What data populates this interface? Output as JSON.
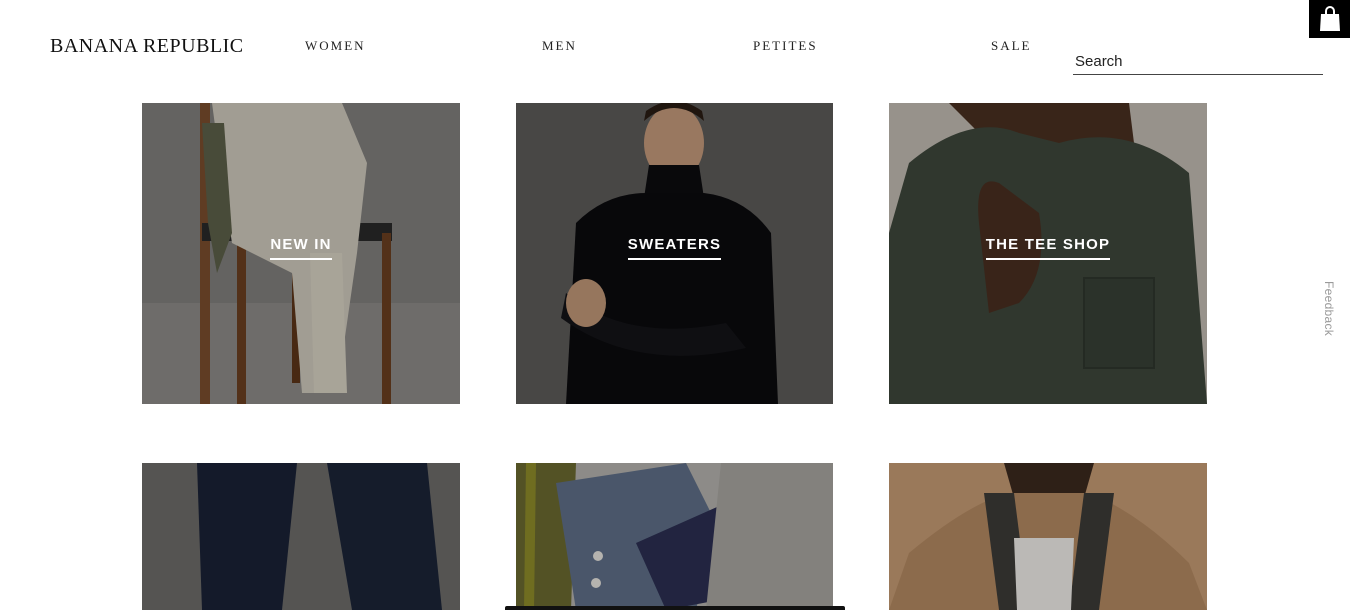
{
  "header": {
    "logo": "BANANA REPUBLIC",
    "nav": [
      "WOMEN",
      "MEN",
      "PETITES",
      "SALE"
    ],
    "search_placeholder": "Search"
  },
  "icons": {
    "bag": "shopping-bag-icon"
  },
  "feedback_label": "Feedback",
  "tiles": [
    {
      "label": "NEW IN",
      "image": "sweater-on-chair"
    },
    {
      "label": "SWEATERS",
      "image": "man-black-turtleneck"
    },
    {
      "label": "THE TEE SHOP",
      "image": "man-green-tee"
    },
    {
      "label": "",
      "image": "navy-trousers"
    },
    {
      "label": "",
      "image": "folded-shirts-jackets"
    },
    {
      "label": "",
      "image": "man-camel-coat"
    }
  ],
  "colors": {
    "bag_bg": "#000000",
    "label_text": "#ffffff"
  }
}
